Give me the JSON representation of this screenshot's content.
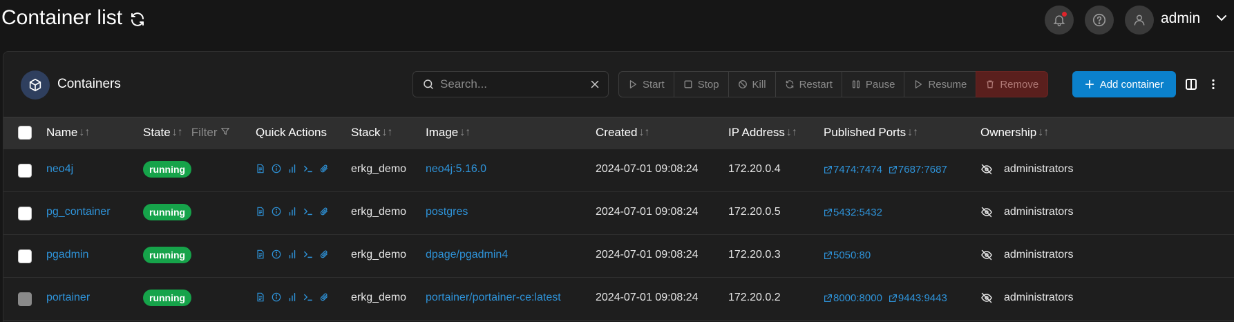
{
  "header": {
    "title": "Container list",
    "username": "admin"
  },
  "panel": {
    "title": "Containers",
    "search_placeholder": "Search...",
    "actions": {
      "start": "Start",
      "stop": "Stop",
      "kill": "Kill",
      "restart": "Restart",
      "pause": "Pause",
      "resume": "Resume",
      "remove": "Remove"
    },
    "add_label": "Add container"
  },
  "table": {
    "columns": {
      "name": "Name",
      "state": "State",
      "state_filter": "Filter",
      "quick_actions": "Quick Actions",
      "stack": "Stack",
      "image": "Image",
      "created": "Created",
      "ip": "IP Address",
      "ports": "Published Ports",
      "ownership": "Ownership"
    },
    "sort_glyph": "↓↑",
    "rows": [
      {
        "name": "neo4j",
        "state": "running",
        "stack": "erkg_demo",
        "image": "neo4j:5.16.0",
        "created": "2024-07-01 09:08:24",
        "ip": "172.20.0.4",
        "ports": [
          "7474:7474",
          "7687:7687"
        ],
        "ownership": "administrators"
      },
      {
        "name": "pg_container",
        "state": "running",
        "stack": "erkg_demo",
        "image": "postgres",
        "created": "2024-07-01 09:08:24",
        "ip": "172.20.0.5",
        "ports": [
          "5432:5432"
        ],
        "ownership": "administrators"
      },
      {
        "name": "pgadmin",
        "state": "running",
        "stack": "erkg_demo",
        "image": "dpage/pgadmin4",
        "created": "2024-07-01 09:08:24",
        "ip": "172.20.0.3",
        "ports": [
          "5050:80"
        ],
        "ownership": "administrators"
      },
      {
        "name": "portainer",
        "state": "running",
        "stack": "erkg_demo",
        "image": "portainer/portainer-ce:latest",
        "created": "2024-07-01 09:08:24",
        "ip": "172.20.0.2",
        "ports": [
          "8000:8000",
          "9443:9443"
        ],
        "ownership": "administrators"
      }
    ]
  },
  "colors": {
    "accent": "#0b81cc",
    "link": "#2e93d9",
    "running": "#16a34a",
    "remove": "#5a1f1d"
  }
}
